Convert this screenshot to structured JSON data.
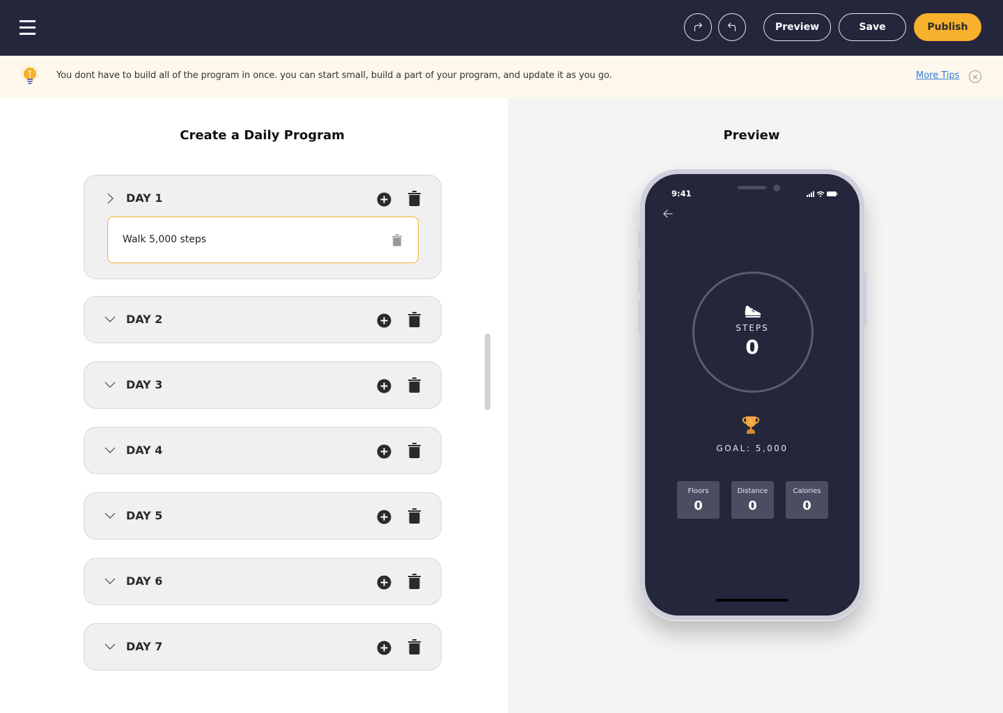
{
  "topbar": {
    "menu_icon": "hamburger-menu-icon",
    "redo_icon": "redo-icon",
    "undo_icon": "undo-icon",
    "preview_label": "Preview",
    "save_label": "Save",
    "publish_label": "Publish",
    "accent_color": "#f7b12c",
    "background_color": "#24263c"
  },
  "tip": {
    "icon": "lightbulb-icon",
    "text": "You dont have to build all of the program in once. you can start small, build a part of your program, and update it as you go.",
    "link_label": "More Tips",
    "close_icon": "close-circle-icon",
    "close_glyph": "×"
  },
  "editor": {
    "title": "Create a Daily Program",
    "days": [
      {
        "label": "DAY 1",
        "expanded": true,
        "tasks": [
          {
            "label": "Walk 5,000 steps"
          }
        ]
      },
      {
        "label": "DAY 2",
        "expanded": false,
        "tasks": []
      },
      {
        "label": "DAY 3",
        "expanded": false,
        "tasks": []
      },
      {
        "label": "DAY 4",
        "expanded": false,
        "tasks": []
      },
      {
        "label": "DAY 5",
        "expanded": false,
        "tasks": []
      },
      {
        "label": "DAY 6",
        "expanded": false,
        "tasks": []
      },
      {
        "label": "DAY 7",
        "expanded": false,
        "tasks": []
      }
    ]
  },
  "preview": {
    "title": "Preview",
    "phone": {
      "time": "9:41",
      "steps_label": "STEPS",
      "steps_value": "0",
      "goal_label": "GOAL: 5,000",
      "stats": [
        {
          "label": "Floors",
          "value": "0"
        },
        {
          "label": "Distance",
          "value": "0"
        },
        {
          "label": "Calories",
          "value": "0"
        }
      ]
    }
  }
}
